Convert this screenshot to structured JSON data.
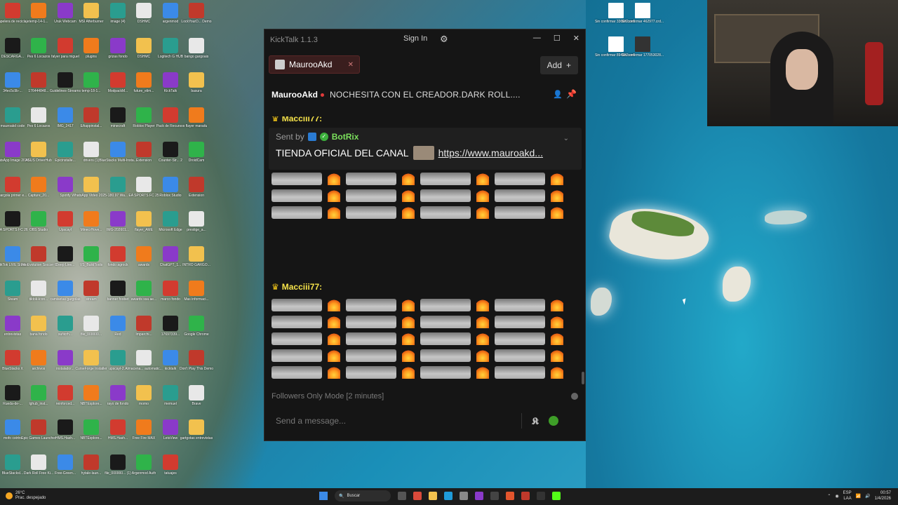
{
  "desktop": {
    "left_icons": [
      {
        "label": "Papelera de reciclaje"
      },
      {
        "label": "temp-14-1..."
      },
      {
        "label": "Uruk Webcam"
      },
      {
        "label": "MSI Afterburner"
      },
      {
        "label": "image (4)"
      },
      {
        "label": "DSHMC"
      },
      {
        "label": "argenmod"
      },
      {
        "label": "LockYourD... Demo"
      },
      {
        "label": "DESCARGA..."
      },
      {
        "label": "Pes 6 Locazos"
      },
      {
        "label": "falyer para miguel"
      },
      {
        "label": "plugins"
      },
      {
        "label": "grizas fondo"
      },
      {
        "label": "DSHMC"
      },
      {
        "label": "Logitech G HUB"
      },
      {
        "label": "bango gargoais"
      },
      {
        "label": "34ec5c9b-..."
      },
      {
        "label": "176444848..."
      },
      {
        "label": "Guidelines-Streams"
      },
      {
        "label": "temp-18-1..."
      },
      {
        "label": "ModpackM..."
      },
      {
        "label": "future_elim..."
      },
      {
        "label": "KickTalk"
      },
      {
        "label": "basura"
      },
      {
        "label": "mauroakd code"
      },
      {
        "label": "Pes 6 Locazos"
      },
      {
        "label": "IMG_2417"
      },
      {
        "label": "EAappinstal..."
      },
      {
        "label": "minecraft"
      },
      {
        "label": "Roblox Player"
      },
      {
        "label": "Pack de Recursos"
      },
      {
        "label": "flayer maradu"
      },
      {
        "label": "WhatsApp Image 2026..."
      },
      {
        "label": "ASUS DriverHub"
      },
      {
        "label": "Epicinstalle..."
      },
      {
        "label": "drivers (1)"
      },
      {
        "label": "BlueStacks Multi-Insta..."
      },
      {
        "label": "Extension"
      },
      {
        "label": "Counter-Str... 2"
      },
      {
        "label": "DroidCam"
      },
      {
        "label": "gargola primer e..."
      },
      {
        "label": "Capture_20..."
      },
      {
        "label": "Spotify"
      },
      {
        "label": "WhatsApp Video 2025-..."
      },
      {
        "label": "180.97 Wa..."
      },
      {
        "label": "EA SPORTS FC 25"
      },
      {
        "label": "Roblox Studio"
      },
      {
        "label": "Extension"
      },
      {
        "label": "EA SPORTS FC 26"
      },
      {
        "label": "OBS Studio"
      },
      {
        "label": "Upscayl"
      },
      {
        "label": "MinecrHove..."
      },
      {
        "label": "IMG-202601..."
      },
      {
        "label": "flayer_AME"
      },
      {
        "label": "Microsoft Edge"
      },
      {
        "label": "prestige_a..."
      },
      {
        "label": "TikTok LIVE Studio"
      },
      {
        "label": "Pro Evolution Soccer 6"
      },
      {
        "label": "Deep Live..."
      },
      {
        "label": "VS_BuildTools"
      },
      {
        "label": "fondo agrock"
      },
      {
        "label": "awards"
      },
      {
        "label": "ChatGPT_1..."
      },
      {
        "label": "INTRO GARGO..."
      },
      {
        "label": "Steam"
      },
      {
        "label": "tiktok-icon..."
      },
      {
        "label": "camisetas gargolas"
      },
      {
        "label": "stream"
      },
      {
        "label": "banner foobet"
      },
      {
        "label": "awards ssa ae..."
      },
      {
        "label": "marco fondo"
      },
      {
        "label": "Mas informaci..."
      },
      {
        "label": "entrevistas"
      },
      {
        "label": "bana fondo"
      },
      {
        "label": "sufiicrh..."
      },
      {
        "label": "file_000000..."
      },
      {
        "label": "Red"
      },
      {
        "label": "Imparchi..."
      },
      {
        "label": "17697339..."
      },
      {
        "label": "Google Chrome"
      },
      {
        "label": "BlueStacks X"
      },
      {
        "label": "archivos"
      },
      {
        "label": "instalador..."
      },
      {
        "label": "CurseForge Installer"
      },
      {
        "label": "upscayl-2..."
      },
      {
        "label": "Almacena... automatic..."
      },
      {
        "label": "kicktalk"
      },
      {
        "label": "Don't Play This Demo"
      },
      {
        "label": "Rueda-de-..."
      },
      {
        "label": "lghub_inst..."
      },
      {
        "label": "reinforced..."
      },
      {
        "label": "NBTExplore..."
      },
      {
        "label": "rayo de fondo"
      },
      {
        "label": "momo"
      },
      {
        "label": "memuel"
      },
      {
        "label": "Brave"
      },
      {
        "label": "mofo cstrtrs"
      },
      {
        "label": "Epic Games Launcher"
      },
      {
        "label": "HMS.Hash..."
      },
      {
        "label": "NBTExplore..."
      },
      {
        "label": "HMS.Hash..."
      },
      {
        "label": "Free Fire MAX"
      },
      {
        "label": "LetsView"
      },
      {
        "label": "gartgotas entrevistas"
      },
      {
        "label": "BlueStacksI..."
      },
      {
        "label": "Dark Roll Free Ki..."
      },
      {
        "label": "Free-Green..."
      },
      {
        "label": "hytale-laun..."
      },
      {
        "label": "file_000000... (1)"
      },
      {
        "label": "Argenmod Auth"
      },
      {
        "label": "tatuajes"
      }
    ],
    "right_icons": [
      {
        "label": "Sin confirmar 336672.crd..."
      },
      {
        "label": "Sin confirmar 462977.crd..."
      },
      {
        "label": "Sin confirmar 894333.crd..."
      },
      {
        "label": "Sin confirmar 177053028..."
      }
    ]
  },
  "chat_window": {
    "app_title": "KickTalk 1.1.3",
    "sign_in_label": "Sign In",
    "add_label": "Add",
    "tab": {
      "label": "MaurooAkd"
    },
    "channel": {
      "name": "MaurooAkd",
      "stream_title": "NOCHESITA CON EL CREADOR.DARK ROLL...."
    },
    "pinned": {
      "sent_by_label": "Sent by",
      "sender": "BotRix",
      "message_text": "TIENDA OFICIAL DEL CANAL",
      "link_text": "https://www.mauroakd..."
    },
    "partial_user_top": "Macciii77:",
    "message_user": "Macciii77:",
    "followers_mode": "Followers Only Mode [2 minutes]",
    "input_placeholder": "Send a message..."
  },
  "taskbar": {
    "weather_temp": "26°C",
    "weather_desc": "Prac. despejado",
    "search_label": "Buscar",
    "lang_top": "ESP",
    "lang_bottom": "LAA",
    "time": "00:57",
    "date": "1/4/2026"
  },
  "colors": {
    "chat_bg": "#151515",
    "tab_bg": "#3a1e1e",
    "live_dot": "#e03a3a",
    "botrix_green": "#7be05c",
    "username_yellow": "#f6e34a"
  }
}
